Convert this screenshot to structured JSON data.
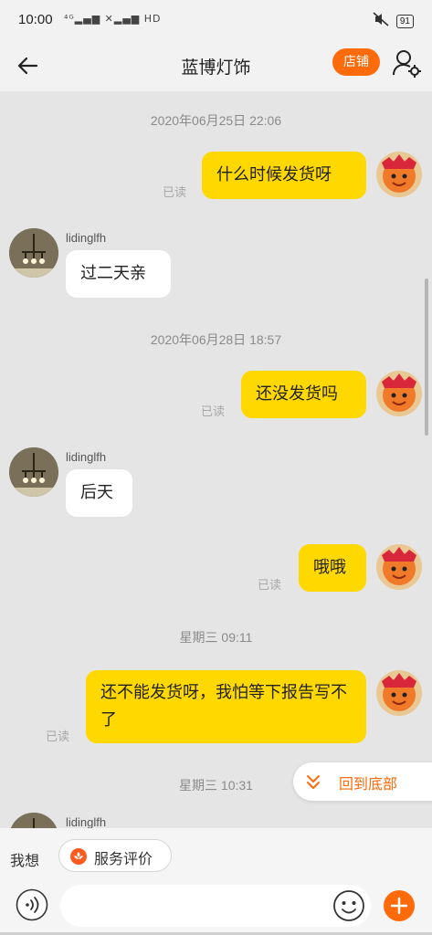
{
  "status_bar": {
    "time": "10:00",
    "signal_text": "⁴ᴳ▂▄▆ ✕▂▄▆ HD",
    "battery": "91",
    "icons": [
      "mute-icon",
      "battery-icon"
    ]
  },
  "header": {
    "title": "蓝博灯饰",
    "store_label": "店铺",
    "icons": [
      "back-arrow-icon",
      "profile-settings-icon"
    ]
  },
  "colors": {
    "accent": "#ff6a0a",
    "my_bubble": "#ffd800",
    "their_bubble": "#ffffff",
    "background": "#e5e5e5"
  },
  "messages": {
    "ts1": "2020年06月25日 22:06",
    "m1_text": "什么时候发货呀",
    "m1_read": "已读",
    "u1_name": "lidinglfh",
    "m2_text": "过二天亲",
    "ts2": "2020年06月28日 18:57",
    "m3_text": "还没发货吗",
    "m3_read": "已读",
    "u2_name": "lidinglfh",
    "m4_text": "后天",
    "m5_text": "哦哦",
    "m5_read": "已读",
    "ts3": "星期三 09:11",
    "m6_text": "还不能发货呀，我怕等下报告写不了",
    "m6_read": "已读",
    "ts4": "星期三 10:31",
    "u3_name": "lidinglfh"
  },
  "goto_bottom_label": "回到底部",
  "quick_bar": {
    "label": "我想",
    "chip_label": "服务评价"
  },
  "input": {
    "value": "",
    "placeholder": ""
  }
}
